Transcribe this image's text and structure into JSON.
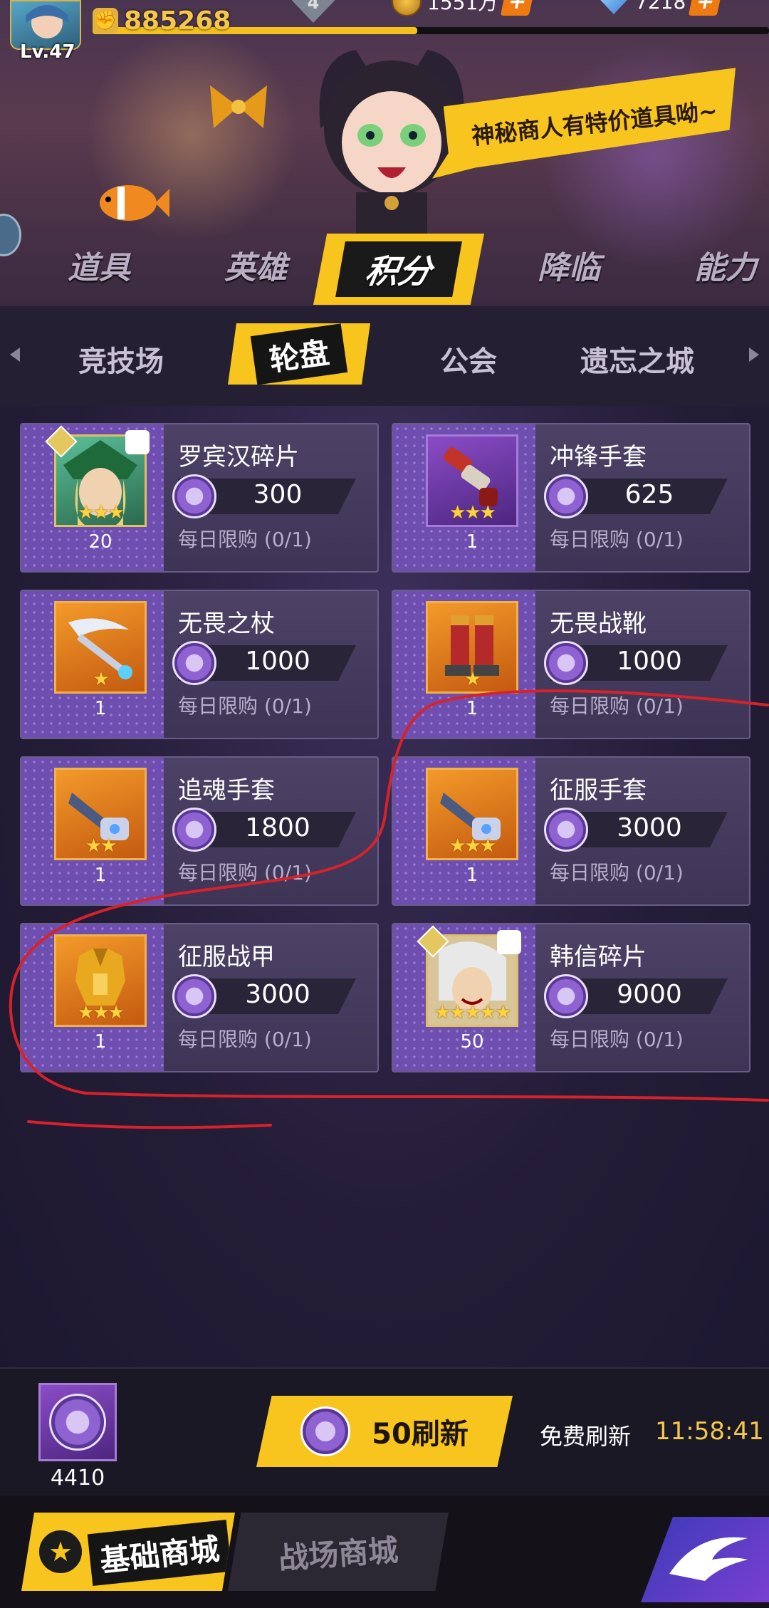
{
  "player": {
    "level": "Lv.47",
    "power": "885268",
    "rank": "4",
    "gold": "1551万",
    "gems": "7218",
    "exp_progress": 0.48
  },
  "banner": {
    "speech": "神秘商人有特价道具呦~"
  },
  "main_tabs": [
    "道具",
    "英雄",
    "积分",
    "降临",
    "能力"
  ],
  "main_tab_active": "积分",
  "sub_tabs": [
    "竞技场",
    "轮盘",
    "公会",
    "遗忘之城"
  ],
  "sub_tab_active": "轮盘",
  "items": [
    {
      "name": "罗宾汉碎片",
      "price": "300",
      "limit": "每日限购 (0/1)",
      "qty": "20",
      "stars": "★★★",
      "icon": "robinhood-portrait-icon"
    },
    {
      "name": "冲锋手套",
      "price": "625",
      "limit": "每日限购 (0/1)",
      "qty": "1",
      "stars": "★★★",
      "icon": "gauntlet-icon"
    },
    {
      "name": "无畏之杖",
      "price": "1000",
      "limit": "每日限购 (0/1)",
      "qty": "1",
      "stars": "★",
      "icon": "staff-icon"
    },
    {
      "name": "无畏战靴",
      "price": "1000",
      "limit": "每日限购 (0/1)",
      "qty": "1",
      "stars": "★",
      "icon": "boots-icon"
    },
    {
      "name": "追魂手套",
      "price": "1800",
      "limit": "每日限购 (0/1)",
      "qty": "1",
      "stars": "★★",
      "icon": "glove-icon"
    },
    {
      "name": "征服手套",
      "price": "3000",
      "limit": "每日限购 (0/1)",
      "qty": "1",
      "stars": "★★★",
      "icon": "glove-icon"
    },
    {
      "name": "征服战甲",
      "price": "3000",
      "limit": "每日限购 (0/1)",
      "qty": "1",
      "stars": "★★★",
      "icon": "armor-icon"
    },
    {
      "name": "韩信碎片",
      "price": "9000",
      "limit": "每日限购 (0/1)",
      "qty": "50",
      "stars": "★★★★★",
      "icon": "hanxin-portrait-icon"
    }
  ],
  "bottom": {
    "currency_amount": "4410",
    "refresh_label": "50刷新",
    "free_refresh_label": "免费刷新",
    "timer": "11:58:41"
  },
  "footer": {
    "tab_basic": "基础商城",
    "tab_battle": "战场商城"
  },
  "colors": {
    "accent": "#f7c51e",
    "annotation": "#d8222a"
  }
}
